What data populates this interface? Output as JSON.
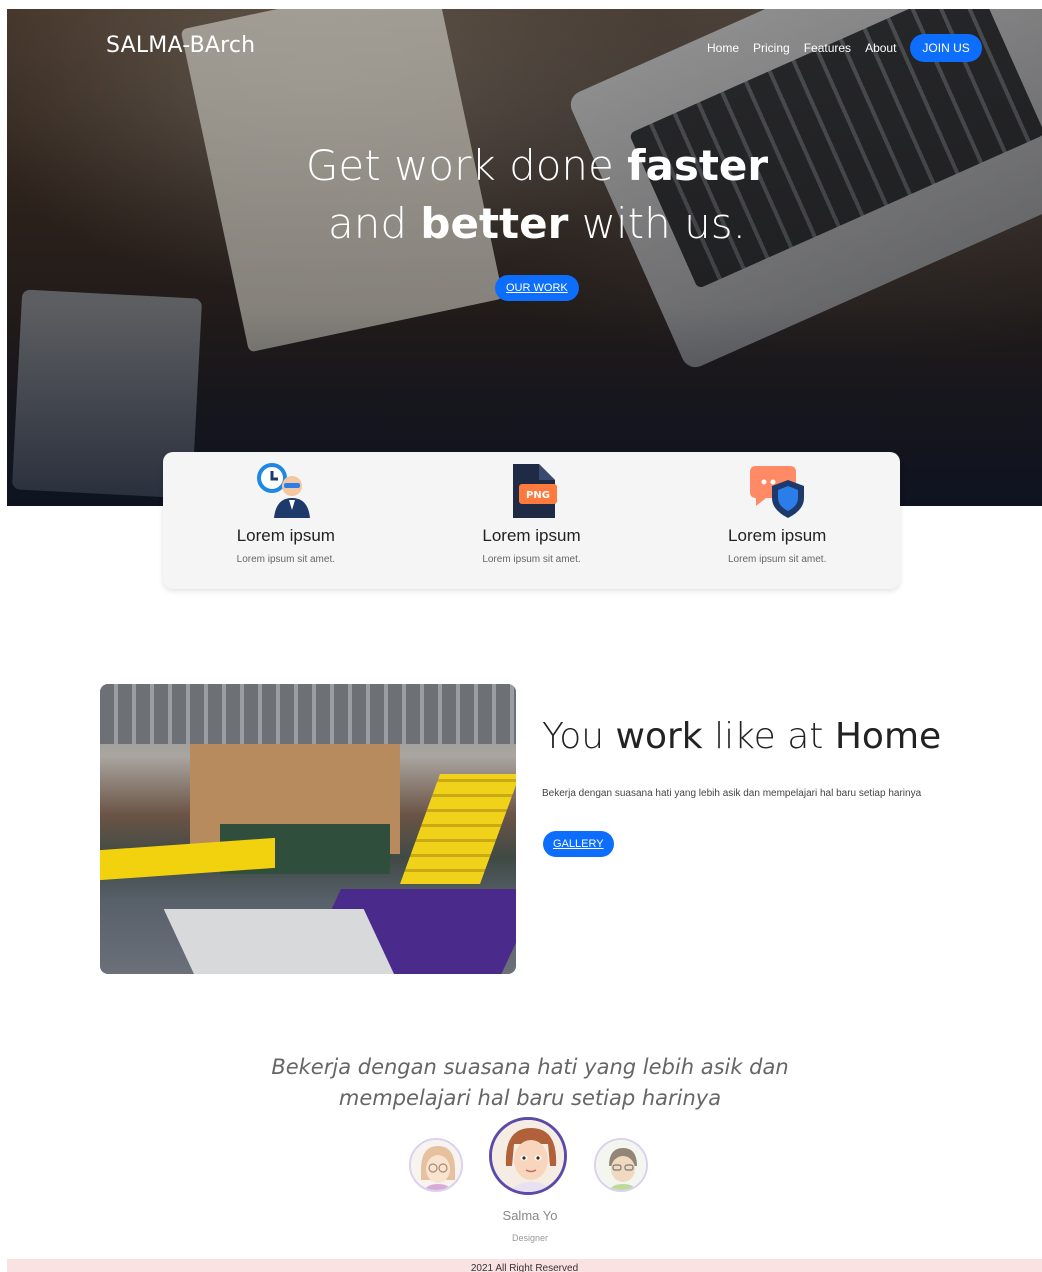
{
  "header": {
    "brand": "SALMA-BArch",
    "nav": [
      "Home",
      "Pricing",
      "Features",
      "About"
    ],
    "join_label": "JOIN US"
  },
  "hero": {
    "line1_a": "Get work done ",
    "line1_b": "faster",
    "line2_a": "and ",
    "line2_b": "better",
    "line2_c": " with us.",
    "button_label": "OUR WORK"
  },
  "features": [
    {
      "icon": "clock-user-icon",
      "title": "Lorem ipsum",
      "text": "Lorem ipsum sit amet."
    },
    {
      "icon": "png-file-icon",
      "title": "Lorem ipsum",
      "text": "Lorem ipsum sit amet."
    },
    {
      "icon": "chat-shield-icon",
      "title": "Lorem ipsum",
      "text": "Lorem ipsum sit amet."
    }
  ],
  "work": {
    "title_a": "You ",
    "title_b": "work",
    "title_c": " like at ",
    "title_d": "Home",
    "text": "Bekerja dengan suasana hati yang lebih asik dan mempelajari hal baru setiap harinya",
    "button_label": "GALLERY"
  },
  "testimonial": {
    "quote_line1": "Bekerja dengan suasana hati yang lebih asik dan",
    "quote_line2": "mempelajari hal baru setiap harinya",
    "name": "Salma Yo",
    "role": "Designer"
  },
  "footer": {
    "text": "2021 All Right Reserved"
  },
  "colors": {
    "primary": "#0d6efd",
    "footer_bg": "#fbe2e2",
    "avatar_ring": "#5b4aa8"
  }
}
